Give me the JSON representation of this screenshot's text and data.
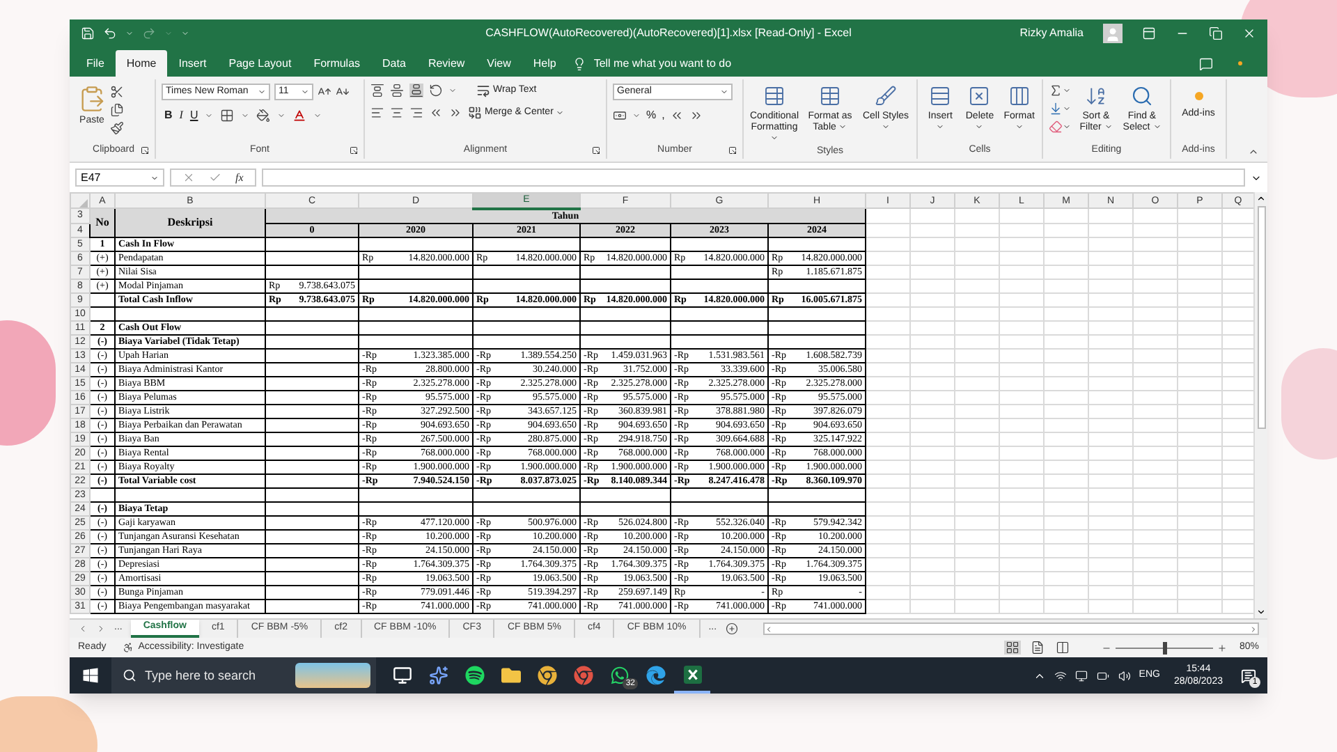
{
  "window": {
    "title": "CASHFLOW(AutoRecovered)(AutoRecovered)[1].xlsx  [Read-Only]  -  Excel",
    "user": "Rizky Amalia",
    "redo_disabled": true
  },
  "menu_tabs": [
    {
      "label": "File",
      "selected": false
    },
    {
      "label": "Home",
      "selected": true
    },
    {
      "label": "Insert",
      "selected": false
    },
    {
      "label": "Page Layout",
      "selected": false
    },
    {
      "label": "Formulas",
      "selected": false
    },
    {
      "label": "Data",
      "selected": false
    },
    {
      "label": "Review",
      "selected": false
    },
    {
      "label": "View",
      "selected": false
    },
    {
      "label": "Help",
      "selected": false
    }
  ],
  "tell_me": "Tell me what you want to do",
  "ribbon": [
    {
      "kind": "clipboard",
      "label": "Clipboard",
      "paste": "Paste"
    },
    {
      "kind": "font",
      "label": "Font",
      "family": "Times New Roman",
      "size": "11",
      "styles": [
        "B",
        "I",
        "U"
      ]
    },
    {
      "kind": "alignment",
      "label": "Alignment",
      "wrap": "Wrap Text",
      "merge": "Merge & Center"
    },
    {
      "kind": "number",
      "label": "Number",
      "format": "General",
      "symbols": [
        "%",
        ","
      ]
    },
    {
      "kind": "styles",
      "label": "Styles",
      "buttons": [
        "Conditional Formatting",
        "Format as Table",
        "Cell Styles"
      ]
    },
    {
      "kind": "cells",
      "label": "Cells",
      "buttons": [
        "Insert",
        "Delete",
        "Format"
      ]
    },
    {
      "kind": "editing",
      "label": "Editing",
      "buttons": [
        "Sort & Filter",
        "Find & Select"
      ]
    },
    {
      "kind": "addins",
      "label": "Add-ins",
      "buttons": [
        "Add-ins"
      ]
    }
  ],
  "formula_bar": {
    "name_box": "E47",
    "fx": "fx"
  },
  "sheet": {
    "column_headers": [
      {
        "label": "A",
        "selected": false
      },
      {
        "label": "B",
        "selected": false
      },
      {
        "label": "C",
        "selected": false
      },
      {
        "label": "D",
        "selected": false
      },
      {
        "label": "E",
        "selected": true
      },
      {
        "label": "F",
        "selected": false
      },
      {
        "label": "G",
        "selected": false
      },
      {
        "label": "H",
        "selected": false
      },
      {
        "label": "I",
        "selected": false
      },
      {
        "label": "J",
        "selected": false
      },
      {
        "label": "K",
        "selected": false
      },
      {
        "label": "L",
        "selected": false
      },
      {
        "label": "M",
        "selected": false
      },
      {
        "label": "N",
        "selected": false
      },
      {
        "label": "O",
        "selected": false
      },
      {
        "label": "P",
        "selected": false
      },
      {
        "label": "Q",
        "selected": false
      }
    ],
    "header": {
      "rows": [
        "3",
        "4"
      ],
      "no": "No",
      "desc": "Deskripsi",
      "group": "Tahun",
      "years": [
        "0",
        "2020",
        "2021",
        "2022",
        "2023",
        "2024"
      ]
    },
    "rows": [
      {
        "row": "5",
        "no": "1",
        "desc": "Cash In Flow",
        "bold": true
      },
      {
        "row": "6",
        "no": "(+)",
        "desc": "Pendapatan",
        "bold": false,
        "values": {
          "D": {
            "cur": "Rp",
            "amt": "14.820.000.000"
          },
          "E": {
            "cur": "Rp",
            "amt": "14.820.000.000"
          },
          "F": {
            "cur": "Rp",
            "amt": "14.820.000.000"
          },
          "G": {
            "cur": "Rp",
            "amt": "14.820.000.000"
          },
          "H": {
            "cur": "Rp",
            "amt": "14.820.000.000"
          }
        }
      },
      {
        "row": "7",
        "no": "(+)",
        "desc": "Nilai Sisa",
        "bold": false,
        "values": {
          "H": {
            "cur": "Rp",
            "amt": "1.185.671.875"
          }
        }
      },
      {
        "row": "8",
        "no": "(+)",
        "desc": "Modal Pinjaman",
        "bold": false,
        "values": {
          "C": {
            "cur": "Rp",
            "amt": "9.738.643.075"
          }
        }
      },
      {
        "row": "9",
        "desc": "Total Cash Inflow",
        "bold": true,
        "values": {
          "C": {
            "cur": "Rp",
            "amt": "9.738.643.075"
          },
          "D": {
            "cur": "Rp",
            "amt": "14.820.000.000"
          },
          "E": {
            "cur": "Rp",
            "amt": "14.820.000.000"
          },
          "F": {
            "cur": "Rp",
            "amt": "14.820.000.000"
          },
          "G": {
            "cur": "Rp",
            "amt": "14.820.000.000"
          },
          "H": {
            "cur": "Rp",
            "amt": "16.005.671.875"
          }
        }
      },
      {
        "row": "10"
      },
      {
        "row": "11",
        "no": "2",
        "desc": "Cash Out Flow",
        "bold": true
      },
      {
        "row": "12",
        "no": "(-)",
        "desc": "Biaya Variabel (Tidak Tetap)",
        "bold": true
      },
      {
        "row": "13",
        "no": "(-)",
        "desc": "Upah Harian",
        "bold": false,
        "values": {
          "D": {
            "cur": "-Rp",
            "amt": "1.323.385.000"
          },
          "E": {
            "cur": "-Rp",
            "amt": "1.389.554.250"
          },
          "F": {
            "cur": "-Rp",
            "amt": "1.459.031.963"
          },
          "G": {
            "cur": "-Rp",
            "amt": "1.531.983.561"
          },
          "H": {
            "cur": "-Rp",
            "amt": "1.608.582.739"
          }
        }
      },
      {
        "row": "14",
        "no": "(-)",
        "desc": "Biaya Administrasi Kantor",
        "bold": false,
        "values": {
          "D": {
            "cur": "-Rp",
            "amt": "28.800.000"
          },
          "E": {
            "cur": "-Rp",
            "amt": "30.240.000"
          },
          "F": {
            "cur": "-Rp",
            "amt": "31.752.000"
          },
          "G": {
            "cur": "-Rp",
            "amt": "33.339.600"
          },
          "H": {
            "cur": "-Rp",
            "amt": "35.006.580"
          }
        }
      },
      {
        "row": "15",
        "no": "(-)",
        "desc": "Biaya BBM",
        "bold": false,
        "values": {
          "D": {
            "cur": "-Rp",
            "amt": "2.325.278.000"
          },
          "E": {
            "cur": "-Rp",
            "amt": "2.325.278.000"
          },
          "F": {
            "cur": "-Rp",
            "amt": "2.325.278.000"
          },
          "G": {
            "cur": "-Rp",
            "amt": "2.325.278.000"
          },
          "H": {
            "cur": "-Rp",
            "amt": "2.325.278.000"
          }
        }
      },
      {
        "row": "16",
        "no": "(-)",
        "desc": "Biaya Pelumas",
        "bold": false,
        "values": {
          "D": {
            "cur": "-Rp",
            "amt": "95.575.000"
          },
          "E": {
            "cur": "-Rp",
            "amt": "95.575.000"
          },
          "F": {
            "cur": "-Rp",
            "amt": "95.575.000"
          },
          "G": {
            "cur": "-Rp",
            "amt": "95.575.000"
          },
          "H": {
            "cur": "-Rp",
            "amt": "95.575.000"
          }
        }
      },
      {
        "row": "17",
        "no": "(-)",
        "desc": "Biaya Listrik",
        "bold": false,
        "values": {
          "D": {
            "cur": "-Rp",
            "amt": "327.292.500"
          },
          "E": {
            "cur": "-Rp",
            "amt": "343.657.125"
          },
          "F": {
            "cur": "-Rp",
            "amt": "360.839.981"
          },
          "G": {
            "cur": "-Rp",
            "amt": "378.881.980"
          },
          "H": {
            "cur": "-Rp",
            "amt": "397.826.079"
          }
        }
      },
      {
        "row": "18",
        "no": "(-)",
        "desc": "Biaya Perbaikan dan Perawatan",
        "bold": false,
        "values": {
          "D": {
            "cur": "-Rp",
            "amt": "904.693.650"
          },
          "E": {
            "cur": "-Rp",
            "amt": "904.693.650"
          },
          "F": {
            "cur": "-Rp",
            "amt": "904.693.650"
          },
          "G": {
            "cur": "-Rp",
            "amt": "904.693.650"
          },
          "H": {
            "cur": "-Rp",
            "amt": "904.693.650"
          }
        }
      },
      {
        "row": "19",
        "no": "(-)",
        "desc": "Biaya Ban",
        "bold": false,
        "values": {
          "D": {
            "cur": "-Rp",
            "amt": "267.500.000"
          },
          "E": {
            "cur": "-Rp",
            "amt": "280.875.000"
          },
          "F": {
            "cur": "-Rp",
            "amt": "294.918.750"
          },
          "G": {
            "cur": "-Rp",
            "amt": "309.664.688"
          },
          "H": {
            "cur": "-Rp",
            "amt": "325.147.922"
          }
        }
      },
      {
        "row": "20",
        "no": "(-)",
        "desc": "Biaya Rental",
        "bold": false,
        "values": {
          "D": {
            "cur": "-Rp",
            "amt": "768.000.000"
          },
          "E": {
            "cur": "-Rp",
            "amt": "768.000.000"
          },
          "F": {
            "cur": "-Rp",
            "amt": "768.000.000"
          },
          "G": {
            "cur": "-Rp",
            "amt": "768.000.000"
          },
          "H": {
            "cur": "-Rp",
            "amt": "768.000.000"
          }
        }
      },
      {
        "row": "21",
        "no": "(-)",
        "desc": "Biaya Royalty",
        "bold": false,
        "values": {
          "D": {
            "cur": "-Rp",
            "amt": "1.900.000.000"
          },
          "E": {
            "cur": "-Rp",
            "amt": "1.900.000.000"
          },
          "F": {
            "cur": "-Rp",
            "amt": "1.900.000.000"
          },
          "G": {
            "cur": "-Rp",
            "amt": "1.900.000.000"
          },
          "H": {
            "cur": "-Rp",
            "amt": "1.900.000.000"
          }
        }
      },
      {
        "row": "22",
        "no": "(-)",
        "desc": "Total Variable cost",
        "bold": true,
        "values": {
          "D": {
            "cur": "-Rp",
            "amt": "7.940.524.150"
          },
          "E": {
            "cur": "-Rp",
            "amt": "8.037.873.025"
          },
          "F": {
            "cur": "-Rp",
            "amt": "8.140.089.344"
          },
          "G": {
            "cur": "-Rp",
            "amt": "8.247.416.478"
          },
          "H": {
            "cur": "-Rp",
            "amt": "8.360.109.970"
          }
        }
      },
      {
        "row": "23"
      },
      {
        "row": "24",
        "no": "(-)",
        "desc": "Biaya Tetap",
        "bold": true
      },
      {
        "row": "25",
        "no": "(-)",
        "desc": "Gaji karyawan",
        "bold": false,
        "values": {
          "D": {
            "cur": "-Rp",
            "amt": "477.120.000"
          },
          "E": {
            "cur": "-Rp",
            "amt": "500.976.000"
          },
          "F": {
            "cur": "-Rp",
            "amt": "526.024.800"
          },
          "G": {
            "cur": "-Rp",
            "amt": "552.326.040"
          },
          "H": {
            "cur": "-Rp",
            "amt": "579.942.342"
          }
        }
      },
      {
        "row": "26",
        "no": "(-)",
        "desc": "Tunjangan Asuransi Kesehatan",
        "bold": false,
        "values": {
          "D": {
            "cur": "-Rp",
            "amt": "10.200.000"
          },
          "E": {
            "cur": "-Rp",
            "amt": "10.200.000"
          },
          "F": {
            "cur": "-Rp",
            "amt": "10.200.000"
          },
          "G": {
            "cur": "-Rp",
            "amt": "10.200.000"
          },
          "H": {
            "cur": "-Rp",
            "amt": "10.200.000"
          }
        }
      },
      {
        "row": "27",
        "no": "(-)",
        "desc": "Tunjangan Hari Raya",
        "bold": false,
        "values": {
          "D": {
            "cur": "-Rp",
            "amt": "24.150.000"
          },
          "E": {
            "cur": "-Rp",
            "amt": "24.150.000"
          },
          "F": {
            "cur": "-Rp",
            "amt": "24.150.000"
          },
          "G": {
            "cur": "-Rp",
            "amt": "24.150.000"
          },
          "H": {
            "cur": "-Rp",
            "amt": "24.150.000"
          }
        }
      },
      {
        "row": "28",
        "no": "(-)",
        "desc": "Depresiasi",
        "bold": false,
        "values": {
          "D": {
            "cur": "-Rp",
            "amt": "1.764.309.375"
          },
          "E": {
            "cur": "-Rp",
            "amt": "1.764.309.375"
          },
          "F": {
            "cur": "-Rp",
            "amt": "1.764.309.375"
          },
          "G": {
            "cur": "-Rp",
            "amt": "1.764.309.375"
          },
          "H": {
            "cur": "-Rp",
            "amt": "1.764.309.375"
          }
        }
      },
      {
        "row": "29",
        "no": "(-)",
        "desc": "Amortisasi",
        "bold": false,
        "values": {
          "D": {
            "cur": "-Rp",
            "amt": "19.063.500"
          },
          "E": {
            "cur": "-Rp",
            "amt": "19.063.500"
          },
          "F": {
            "cur": "-Rp",
            "amt": "19.063.500"
          },
          "G": {
            "cur": "-Rp",
            "amt": "19.063.500"
          },
          "H": {
            "cur": "-Rp",
            "amt": "19.063.500"
          }
        }
      },
      {
        "row": "30",
        "no": "(-)",
        "desc": "Bunga Pinjaman",
        "bold": false,
        "values": {
          "D": {
            "cur": "-Rp",
            "amt": "779.091.446"
          },
          "E": {
            "cur": "-Rp",
            "amt": "519.394.297"
          },
          "F": {
            "cur": "-Rp",
            "amt": "259.697.149"
          },
          "G": {
            "cur": "Rp",
            "amt": "-"
          },
          "H": {
            "cur": "Rp",
            "amt": "-"
          }
        }
      },
      {
        "row": "31",
        "no": "(-)",
        "desc": "Biaya Pengembangan masyarakat",
        "bold": false,
        "values": {
          "D": {
            "cur": "-Rp",
            "amt": "741.000.000"
          },
          "E": {
            "cur": "-Rp",
            "amt": "741.000.000"
          },
          "F": {
            "cur": "-Rp",
            "amt": "741.000.000"
          },
          "G": {
            "cur": "-Rp",
            "amt": "741.000.000"
          },
          "H": {
            "cur": "-Rp",
            "amt": "741.000.000"
          }
        }
      }
    ]
  },
  "sheet_tabs": {
    "overflow_left": "...",
    "overflow_right": "...",
    "tabs": [
      {
        "label": "Cashflow",
        "selected": true
      },
      {
        "label": "cf1",
        "selected": false
      },
      {
        "label": "CF BBM -5%",
        "selected": false
      },
      {
        "label": "cf2",
        "selected": false
      },
      {
        "label": "CF BBM -10%",
        "selected": false
      },
      {
        "label": "CF3",
        "selected": false
      },
      {
        "label": "CF BBM 5%",
        "selected": false
      },
      {
        "label": "cf4",
        "selected": false
      },
      {
        "label": "CF BBM 10%",
        "selected": false
      }
    ]
  },
  "status_bar": {
    "ready": "Ready",
    "accessibility": "Accessibility: Investigate",
    "views": [
      {
        "selected": true
      },
      {
        "selected": false
      },
      {
        "selected": false
      }
    ],
    "zoom": {
      "level": 0.5,
      "label": "80%"
    }
  },
  "taskbar": {
    "search_placeholder": "Type here to search",
    "chat_badge": "32",
    "language": "ENG",
    "time": "15:44",
    "date": "28/08/2023",
    "notifications": "1"
  }
}
